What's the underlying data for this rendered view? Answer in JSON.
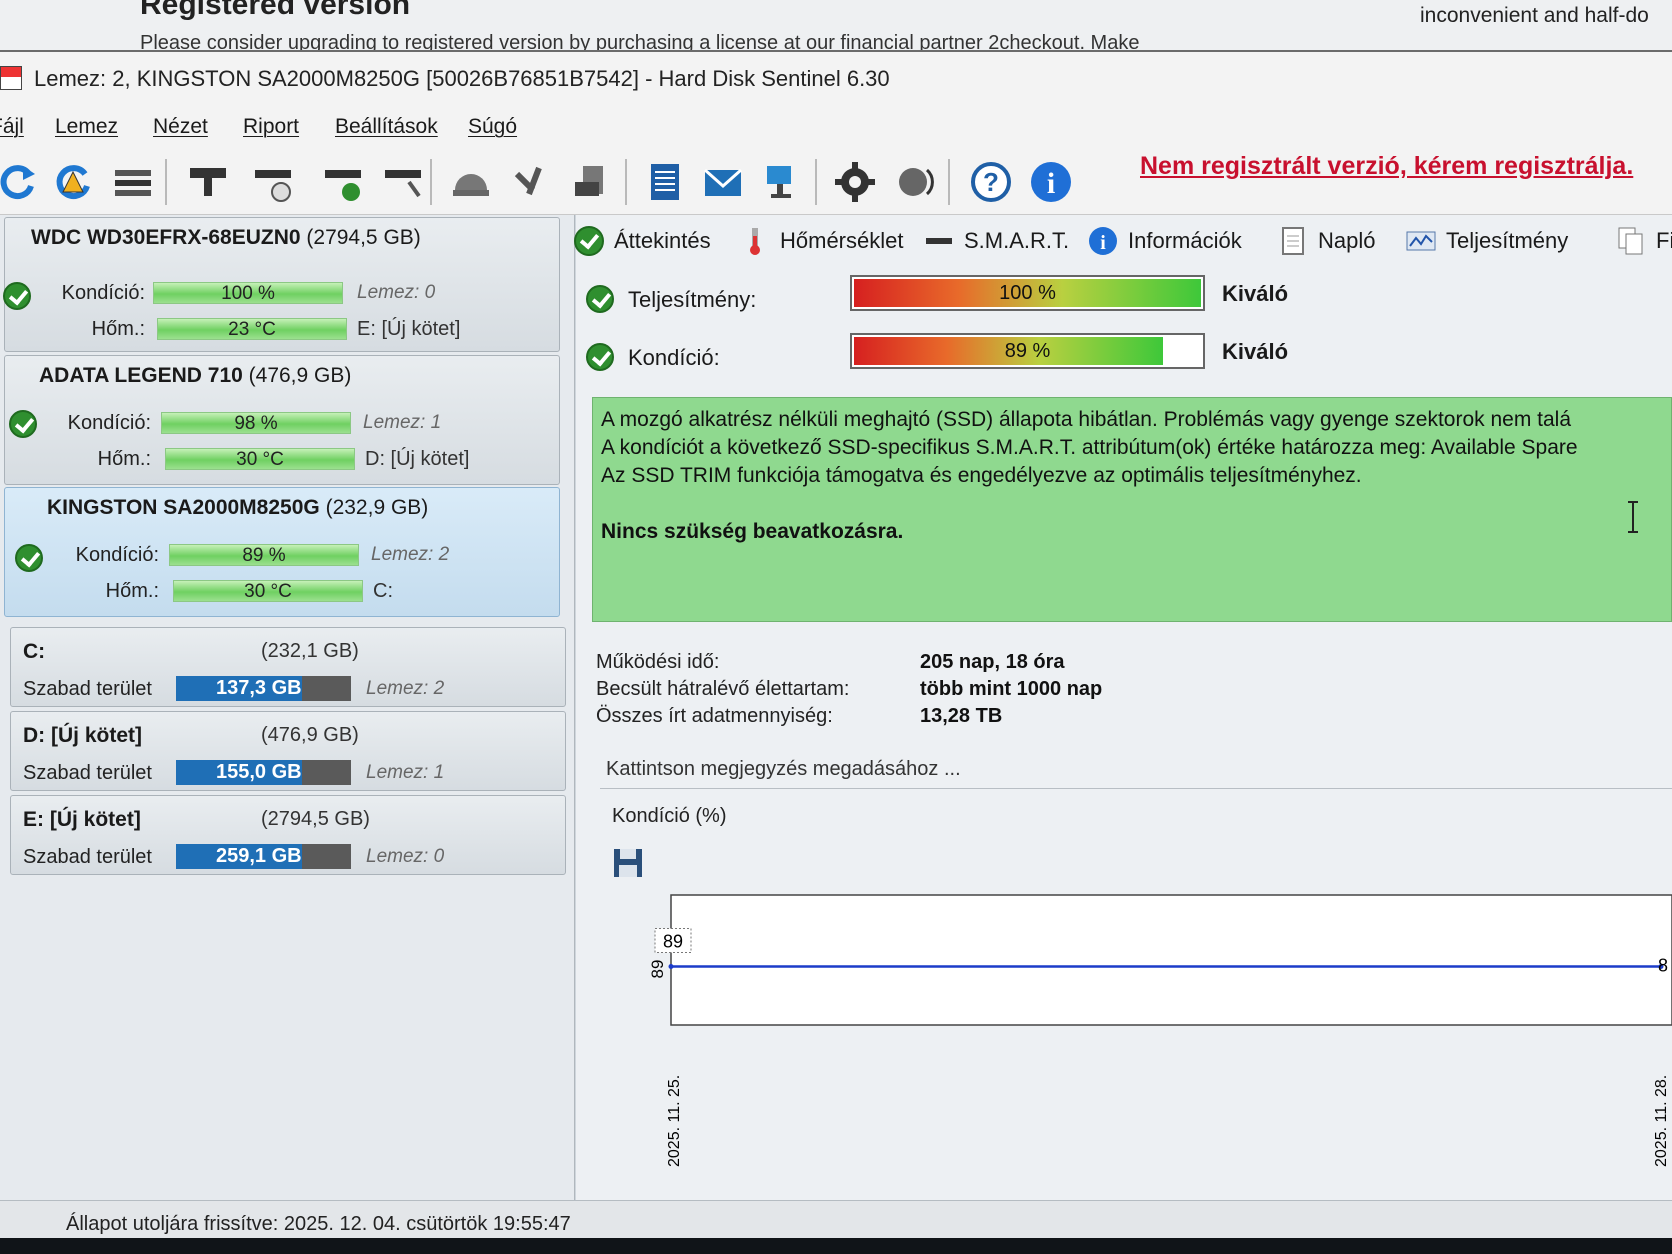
{
  "background_window": {
    "title": "Registered version",
    "message": "Please consider upgrading to registered version by purchasing a license at our financial partner 2checkout. Make",
    "right_text": "inconvenient and half-do"
  },
  "window": {
    "title": "Lemez: 2, KINGSTON SA2000M8250G [50026B76851B7542]  -  Hard Disk Sentinel 6.30"
  },
  "menu": [
    "Fájl",
    "Lemez",
    "Nézet",
    "Riport",
    "Beállítások",
    "Súgó"
  ],
  "toolbar": {
    "unregistered_notice": "Nem regisztrált verzió, kérem regisztrálja."
  },
  "disks": [
    {
      "name": "WDC WD30EFRX-68EUZN0",
      "size": "(2794,5 GB)",
      "condition_label": "Kondíció:",
      "condition": "100 %",
      "temp_label": "Hőm.:",
      "temp": "23 °C",
      "disk_index": "Lemez: 0",
      "volume": "E: [Új kötet]"
    },
    {
      "name": "ADATA LEGEND 710",
      "size": "(476,9 GB)",
      "condition_label": "Kondíció:",
      "condition": "98 %",
      "temp_label": "Hőm.:",
      "temp": "30 °C",
      "disk_index": "Lemez: 1",
      "volume": "D: [Új kötet]"
    },
    {
      "name": "KINGSTON SA2000M8250G",
      "size": "(232,9 GB)",
      "condition_label": "Kondíció:",
      "condition": "89 %",
      "temp_label": "Hőm.:",
      "temp": "30 °C",
      "disk_index": "Lemez: 2",
      "volume": "C:"
    }
  ],
  "volumes": [
    {
      "name": "C:",
      "size": "(232,1 GB)",
      "free_label": "Szabad terület",
      "free": "137,3 GB",
      "disk": "Lemez: 2"
    },
    {
      "name": "D: [Új kötet]",
      "size": "(476,9 GB)",
      "free_label": "Szabad terület",
      "free": "155,0 GB",
      "disk": "Lemez: 1"
    },
    {
      "name": "E: [Új kötet]",
      "size": "(2794,5 GB)",
      "free_label": "Szabad terület",
      "free": "259,1 GB",
      "disk": "Lemez: 0"
    }
  ],
  "tabs": [
    "Áttekintés",
    "Hőmérséklet",
    "S.M.A.R.T.",
    "Információk",
    "Napló",
    "Teljesítmény",
    "Fi"
  ],
  "gauges": {
    "performance": {
      "label": "Teljesítmény:",
      "value": "100 %",
      "percent": 100,
      "verdict": "Kiváló"
    },
    "condition": {
      "label": "Kondíció:",
      "value": "89 %",
      "percent": 89,
      "verdict": "Kiváló"
    }
  },
  "status": {
    "line1": "A mozgó alkatrész nélküli meghajtó (SSD) állapota hibátlan. Problémás vagy gyenge szektorok nem talá",
    "line2": "A kondíciót a következő SSD-specifikus S.M.A.R.T. attribútum(ok) értéke határozza meg:  Available Spare",
    "line3": "Az SSD TRIM funkciója támogatva és engedélyezve az optimális teljesítményhez.",
    "action": "Nincs szükség beavatkozásra."
  },
  "info": {
    "uptime_label": "Működési idő:",
    "uptime": "205 nap, 18 óra",
    "lifetime_label": "Becsült hátralévő élettartam:",
    "lifetime": "több mint 1000 nap",
    "written_label": "Összes írt adatmennyiség:",
    "written": "13,28 TB"
  },
  "note_placeholder": "Kattintson megjegyzés megadásához ...",
  "chart_header": "Kondíció  (%)",
  "chart_data": {
    "type": "line",
    "title": "Kondíció  (%)",
    "x": [
      "2025. 11. 25.",
      "2025. 11. 28."
    ],
    "series": [
      {
        "values": [
          89,
          89
        ]
      }
    ],
    "point_label": "89",
    "y_tick": "89",
    "partial_label": "8",
    "grid": false
  },
  "statusbar": "Állapot utoljára frissítve: 2025. 12. 04. csütörtök 19:55:47",
  "colors": {
    "accent_green": "#2f8f2f",
    "bar_green": "#6fd061",
    "status_green": "#8fd98f",
    "free_blue": "#1f6fb6",
    "warning_red": "#c8102e",
    "chart_line": "#1c3cc9"
  }
}
